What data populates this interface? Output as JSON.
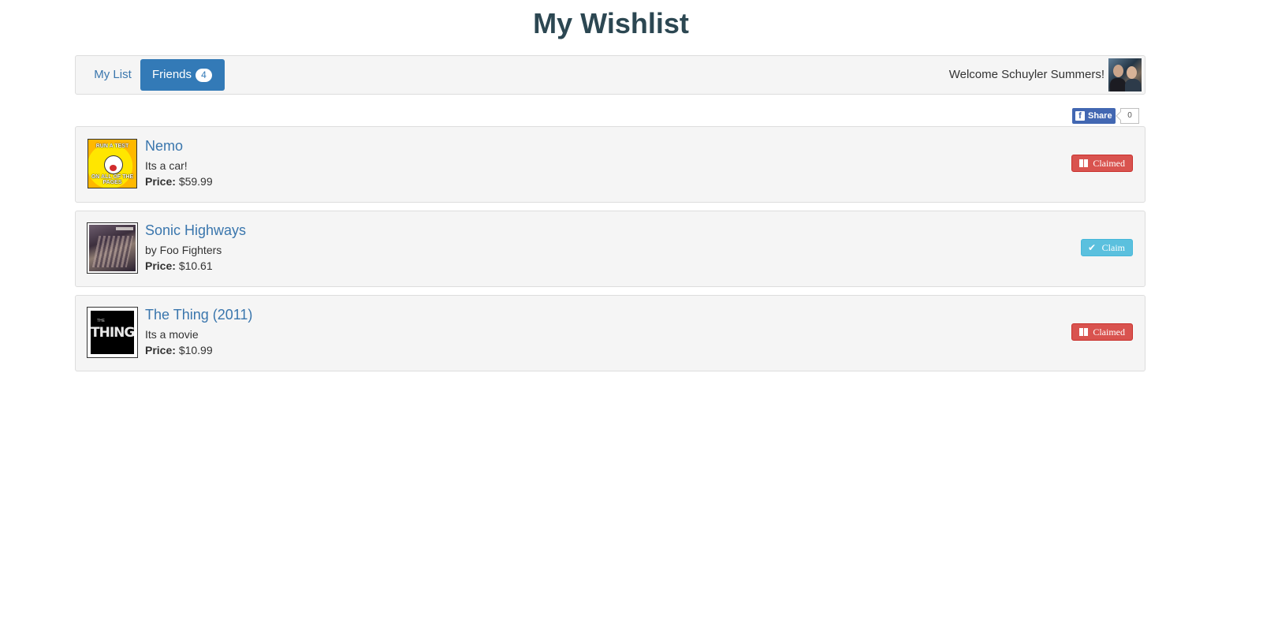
{
  "page": {
    "title": "My Wishlist"
  },
  "navbar": {
    "tabs": [
      {
        "label": "My List",
        "active": false
      },
      {
        "label": "Friends",
        "active": true,
        "badge": "4"
      }
    ],
    "welcome_text": "Welcome Schuyler Summers!",
    "avatar": "user-avatar-photo"
  },
  "share": {
    "label": "Share",
    "icon": "facebook-icon",
    "count": "0"
  },
  "items": [
    {
      "title": "Nemo",
      "description": "Its a car!",
      "price_label": "Price:",
      "price": "$59.99",
      "image": "meme-thumbnail",
      "image_text_top": "RUN A TEST",
      "image_text_bottom": "ON ALL OF THE PAGES",
      "action": {
        "label": "Claimed",
        "state": "claimed",
        "icon": "gift-icon",
        "color": "#d9534f"
      }
    },
    {
      "title": "Sonic Highways",
      "description": "by Foo Fighters",
      "price_label": "Price:",
      "price": "$10.61",
      "image": "album-cover-thumbnail",
      "action": {
        "label": "Claim",
        "state": "available",
        "icon": "check-icon",
        "color": "#5bc0de"
      }
    },
    {
      "title": "The Thing (2011)",
      "description": "Its a movie",
      "price_label": "Price:",
      "price": "$10.99",
      "image": "movie-poster-thumbnail",
      "image_text_small": "THE",
      "image_text": "THING",
      "action": {
        "label": "Claimed",
        "state": "claimed",
        "icon": "gift-icon",
        "color": "#d9534f"
      }
    }
  ],
  "colors": {
    "title": "#2c4752",
    "link": "#3a76ad",
    "primary": "#337ab7",
    "danger": "#d9534f",
    "info": "#5bc0de",
    "facebook": "#4267b2"
  }
}
